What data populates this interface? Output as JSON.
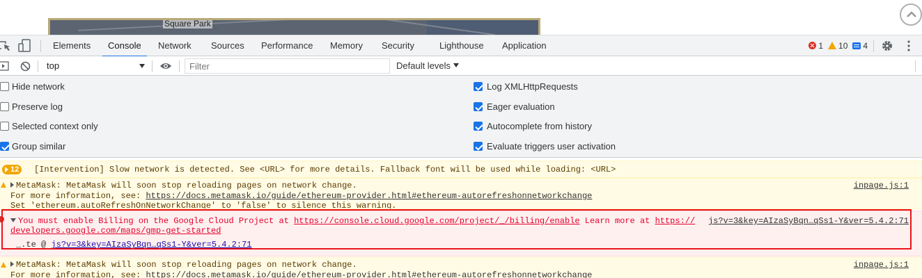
{
  "page": {
    "map_label": "Square Park"
  },
  "tabs": [
    {
      "label": "Elements"
    },
    {
      "label": "Console"
    },
    {
      "label": "Network"
    },
    {
      "label": "Sources"
    },
    {
      "label": "Performance"
    },
    {
      "label": "Memory"
    },
    {
      "label": "Security"
    },
    {
      "label": "Lighthouse"
    },
    {
      "label": "Application"
    }
  ],
  "counts": {
    "errors": "1",
    "warnings": "10",
    "info": "4"
  },
  "filterbar": {
    "context": "top",
    "filter_placeholder": "Filter",
    "levels": "Default levels"
  },
  "settings": {
    "left": [
      {
        "label": "Hide network",
        "checked": false
      },
      {
        "label": "Preserve log",
        "checked": false
      },
      {
        "label": "Selected context only",
        "checked": false
      },
      {
        "label": "Group similar",
        "checked": true
      }
    ],
    "right": [
      {
        "label": "Log XMLHttpRequests",
        "checked": true
      },
      {
        "label": "Eager evaluation",
        "checked": true
      },
      {
        "label": "Autocomplete from history",
        "checked": true
      },
      {
        "label": "Evaluate triggers user activation",
        "checked": true
      }
    ]
  },
  "console": {
    "intervention": {
      "count": "12",
      "text": "[Intervention] Slow network is detected. See <URL> for more details. Fallback font will be used while loading: <URL>"
    },
    "warn1": {
      "line1": "MetaMask: MetaMask will soon stop reloading pages on network change.",
      "line2_prefix": "For more information, see: ",
      "line2_link": "https://docs.metamask.io/guide/ethereum-provider.html#ethereum-autorefreshonnetworkchange",
      "line3": "Set 'ethereum.autoRefreshOnNetworkChange' to 'false' to silence this warning.",
      "source": "inpage.js:1"
    },
    "error": {
      "line1_prefix": "You must enable Billing on the Google Cloud Project at ",
      "line1_link": "https://console.cloud.google.com/project/_/billing/enable",
      "line1_mid": " Learn more at ",
      "line1_link2": "https://",
      "line2_link": "developers.google.com/maps/gmp-get-started",
      "stack_prefix": "_.te @ ",
      "stack_link": "js?v=3&key=AIzaSyBqn…qSs1-Y&ver=5.4.2:71",
      "source": "js?v=3&key=AIzaSyBqn…qSs1-Y&ver=5.4.2:71"
    },
    "warn2": {
      "line1": "MetaMask: MetaMask will soon stop reloading pages on network change.",
      "line2_prefix": "For more information, see: ",
      "line2_link": "https://docs.metamask.io/guide/ethereum-provider.html#ethereum-autorefreshonnetworkchange",
      "source": "inpage.js:1"
    }
  },
  "colors": {
    "accent": "#1a73e8",
    "error": "#d93025",
    "warning": "#f2a600",
    "highlight": "#e8141b"
  }
}
